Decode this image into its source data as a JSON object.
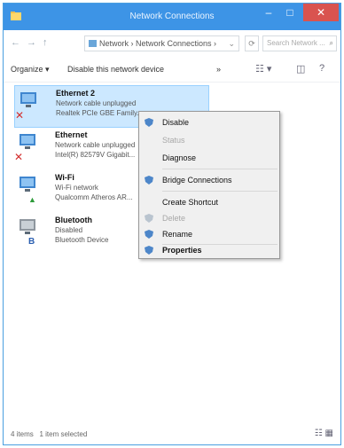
{
  "window": {
    "title": "Network Connections",
    "min_glyph": "–",
    "max_glyph": "□",
    "close_glyph": "✕"
  },
  "address": {
    "back": "←",
    "forward": "→",
    "up": "↑",
    "path": "Network › Network Connections ›",
    "dropdown": "⌄",
    "refresh": "⟳",
    "search_placeholder": "Search Network ...",
    "search_glyph": "⌕"
  },
  "toolbar": {
    "organize": "Organize ▾",
    "disable": "Disable this network device",
    "more": "»",
    "view": "☷ ▾",
    "pane": "◫",
    "help": "?"
  },
  "items": [
    {
      "name": "Ethernet 2",
      "line1": "Network cable unplugged",
      "line2": "Realtek PCIe GBE Family...",
      "badge": "✕",
      "badge_color": "#d32f2f"
    },
    {
      "name": "Ethernet",
      "line1": "Network cable unplugged",
      "line2": "Intel(R) 82579V Gigabit...",
      "badge": "✕",
      "badge_color": "#d32f2f"
    },
    {
      "name": "Wi-Fi",
      "line1": "Wi-Fi network",
      "line2": "Qualcomm Atheros AR...",
      "badge": "▲",
      "badge_color": "#2e9b3a"
    },
    {
      "name": "Bluetooth",
      "line1": "Disabled",
      "line2": "Bluetooth Device",
      "badge": "B",
      "badge_color": "#2b5fb0"
    }
  ],
  "context_menu": [
    {
      "label": "Disable",
      "icon": "shield-icon",
      "disabled": false,
      "bold": false
    },
    {
      "label": "Status",
      "icon": "",
      "disabled": true,
      "bold": false
    },
    {
      "label": "Diagnose",
      "icon": "",
      "disabled": false,
      "bold": false
    },
    {
      "label": "Bridge Connections",
      "icon": "shield-icon",
      "disabled": false,
      "bold": false
    },
    {
      "label": "Create Shortcut",
      "icon": "",
      "disabled": false,
      "bold": false
    },
    {
      "label": "Delete",
      "icon": "shield-icon",
      "disabled": true,
      "bold": false
    },
    {
      "label": "Rename",
      "icon": "shield-icon",
      "disabled": false,
      "bold": false
    },
    {
      "label": "Properties",
      "icon": "shield-icon",
      "disabled": false,
      "bold": true
    }
  ],
  "status": {
    "count": "4 items",
    "selected": "1 item selected",
    "view_glyphs": "☷ ▦"
  },
  "colors": {
    "titlebar": "#3d94e6",
    "selection": "#cce8ff",
    "menu_bg": "#f0f0f0"
  }
}
